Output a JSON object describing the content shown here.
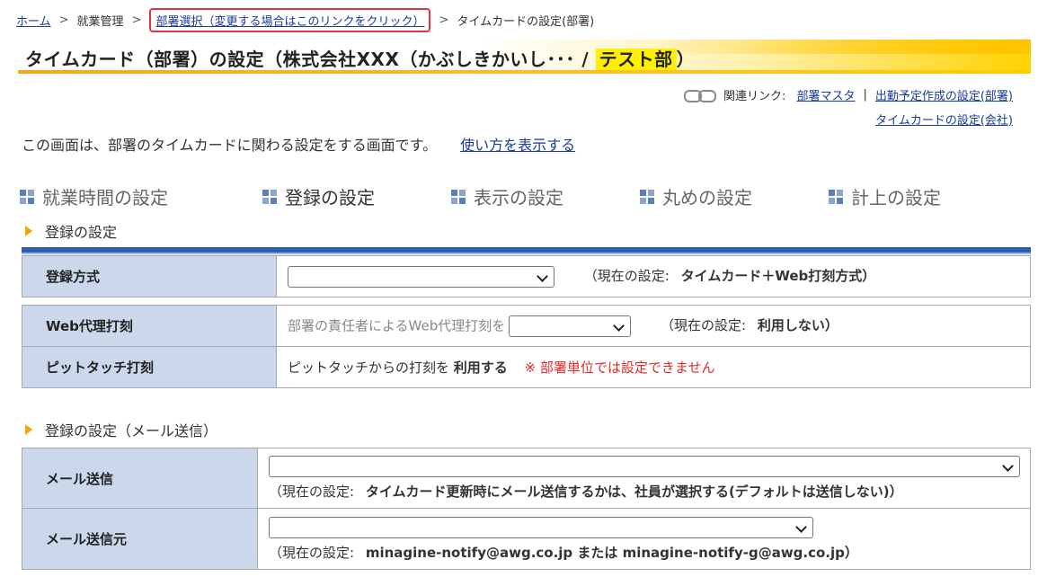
{
  "breadcrumb": {
    "home": "ホーム",
    "sep": ">",
    "work": "就業管理",
    "dept_select": "部署選択（変更する場合はこのリンクをクリック）",
    "current": "タイムカードの設定(部署)"
  },
  "title": {
    "main": "タイムカード（部署）の設定（株式会社XXX（かぶしきかいし･･･ / ",
    "dept": "テスト部",
    "close": "）"
  },
  "related": {
    "label": "関連リンク:",
    "links": [
      "部署マスタ",
      "出勤予定作成の設定(部署)",
      "タイムカードの設定(会社)"
    ],
    "pipe": "|"
  },
  "description": {
    "text": "この画面は、部署のタイムカードに関わる設定をする画面です。",
    "howto": "使い方を表示する"
  },
  "tabs": [
    {
      "label": "就業時間の設定",
      "active": false
    },
    {
      "label": "登録の設定",
      "active": true
    },
    {
      "label": "表示の設定",
      "active": false
    },
    {
      "label": "丸めの設定",
      "active": false
    },
    {
      "label": "計上の設定",
      "active": false
    }
  ],
  "section1": {
    "heading": "登録の設定",
    "rows": [
      {
        "label": "登録方式",
        "current_prefix": "（現在の設定:",
        "current_value": "タイムカード＋Web打刻方式）"
      },
      {
        "label": "Web代理打刻",
        "text": "部署の責任者によるWeb代理打刻を",
        "current_prefix": "（現在の設定:",
        "current_value": "利用しない）"
      },
      {
        "label": "ピットタッチ打刻",
        "text": "ピットタッチからの打刻を",
        "value": "利用する",
        "note": "※ 部署単位では設定できません"
      }
    ]
  },
  "section2": {
    "heading": "登録の設定（メール送信）",
    "rows": [
      {
        "label": "メール送信",
        "current_prefix": "（現在の設定:",
        "current_value": "タイムカード更新時にメール送信するかは、社員が選択する(デフォルトは送信しない)）"
      },
      {
        "label": "メール送信元",
        "current_prefix": "（現在の設定:",
        "current_value": "minagine-notify@awg.co.jp または minagine-notify-g@awg.co.jp）"
      }
    ]
  },
  "colors": {
    "accent": "#2d5fb5",
    "label_bg": "#cbd8ec",
    "highlight": "#ffef00",
    "alert": "#e02a2a"
  }
}
